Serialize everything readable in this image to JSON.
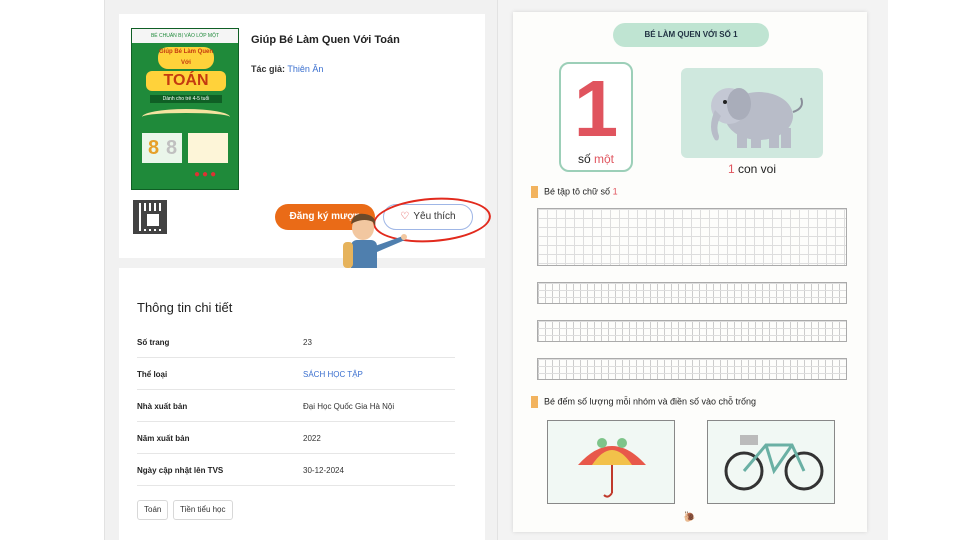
{
  "book": {
    "title": "Giúp Bé Làm Quen Với Toán",
    "author_label": "Tác giả:",
    "author_name": "Thiên Ân",
    "cover_band": "BÉ CHUẨN BỊ VÀO LỚP MỘT",
    "cover_title_top": "Giúp Bé Làm Quen Với",
    "cover_title_main": "TOÁN",
    "cover_sub": "Dành cho trẻ 4-5 tuổi"
  },
  "actions": {
    "register_label": "Đăng ký mượn",
    "favorite_label": "Yêu thích"
  },
  "details": {
    "heading": "Thông tin chi tiết",
    "rows": [
      {
        "key": "Số trang",
        "value": "23"
      },
      {
        "key": "Thể loại",
        "value": "SÁCH HỌC TẬP"
      },
      {
        "key": "Nhà xuất bản",
        "value": "Đại Học Quốc Gia Hà Nội"
      },
      {
        "key": "Năm xuất bản",
        "value": "2022"
      },
      {
        "key": "Ngày cập nhật lên TVS",
        "value": "30-12-2024"
      }
    ],
    "tags": [
      "Toán",
      "Tiền tiểu học"
    ]
  },
  "preview": {
    "heading": "BÉ LÀM QUEN VỚI SỐ 1",
    "number": "1",
    "number_caption_a": "số",
    "number_caption_b": "một",
    "picture_caption_num": "1",
    "picture_caption_text": "con voi",
    "instruction_1_text": "Bé tập tô chữ số",
    "instruction_1_num": "1",
    "instruction_2": "Bé đếm số lượng mỗi nhóm và điền số vào chỗ trống"
  },
  "colors": {
    "accent_orange": "#ea6b17",
    "annotation_red": "#e22a1d",
    "number_red": "#e0545e",
    "pill_green": "#bfe4d2"
  }
}
